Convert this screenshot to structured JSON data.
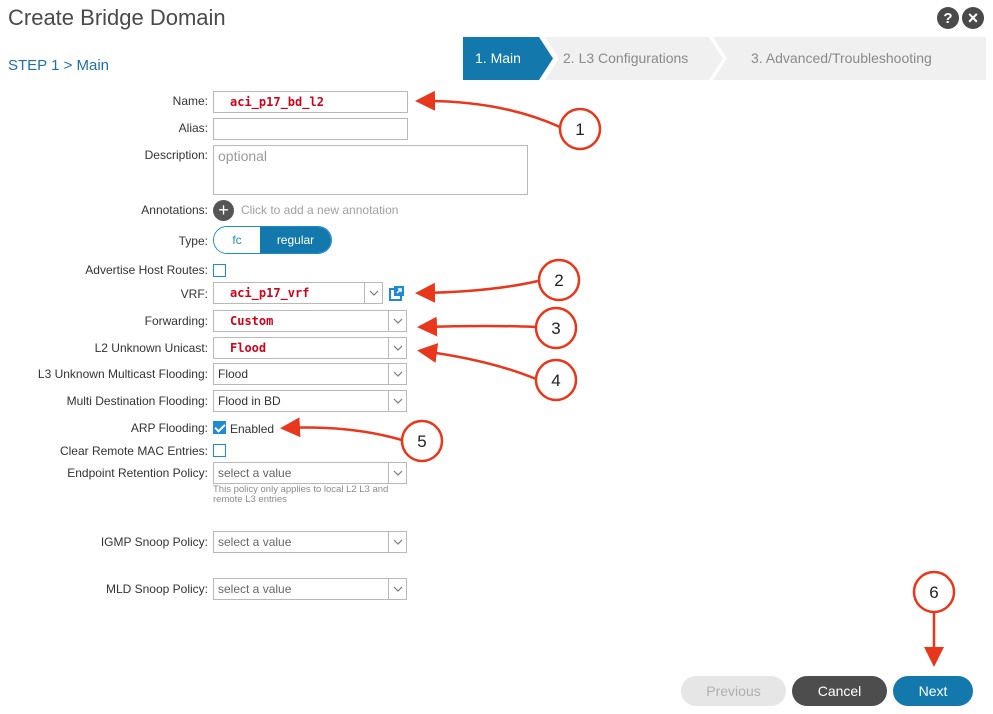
{
  "header": {
    "title": "Create Bridge Domain",
    "help_icon": "?",
    "close_icon": "×"
  },
  "wizard": {
    "step_label": "STEP 1 > Main",
    "steps": [
      {
        "label": "1. Main"
      },
      {
        "label": "2. L3 Configurations"
      },
      {
        "label": "3. Advanced/Troubleshooting"
      }
    ]
  },
  "form": {
    "name": {
      "label": "Name:",
      "value": "aci_p17_bd_l2"
    },
    "alias": {
      "label": "Alias:",
      "value": ""
    },
    "description": {
      "label": "Description:",
      "placeholder": "optional"
    },
    "annotations": {
      "label": "Annotations:",
      "hint": "Click to add a new annotation"
    },
    "type": {
      "label": "Type:",
      "options": [
        "fc",
        "regular"
      ],
      "selected": "regular"
    },
    "advertise_host_routes": {
      "label": "Advertise Host Routes:",
      "checked": false
    },
    "vrf": {
      "label": "VRF:",
      "value": "aci_p17_vrf"
    },
    "forwarding": {
      "label": "Forwarding:",
      "value": "Custom"
    },
    "l2_unknown_unicast": {
      "label": "L2 Unknown Unicast:",
      "value": "Flood"
    },
    "l3_unknown_multicast": {
      "label": "L3 Unknown Multicast Flooding:",
      "value": "Flood"
    },
    "multi_destination": {
      "label": "Multi Destination Flooding:",
      "value": "Flood in BD"
    },
    "arp_flooding": {
      "label": "ARP Flooding:",
      "checked": true,
      "text": "Enabled"
    },
    "clear_remote_mac": {
      "label": "Clear Remote MAC Entries:",
      "checked": false
    },
    "endpoint_retention": {
      "label": "Endpoint Retention Policy:",
      "value": "select a value",
      "hint": "This policy only applies to local L2 L3 and remote L3 entries"
    },
    "igmp_snoop": {
      "label": "IGMP Snoop Policy:",
      "value": "select a value"
    },
    "mld_snoop": {
      "label": "MLD Snoop Policy:",
      "value": "select a value"
    }
  },
  "footer": {
    "previous_label": "Previous",
    "cancel_label": "Cancel",
    "next_label": "Next"
  },
  "callouts": [
    "1",
    "2",
    "3",
    "4",
    "5",
    "6"
  ],
  "colors": {
    "accent": "#1379ac",
    "callout": "#e8371c",
    "value_red": "#d0021b"
  }
}
